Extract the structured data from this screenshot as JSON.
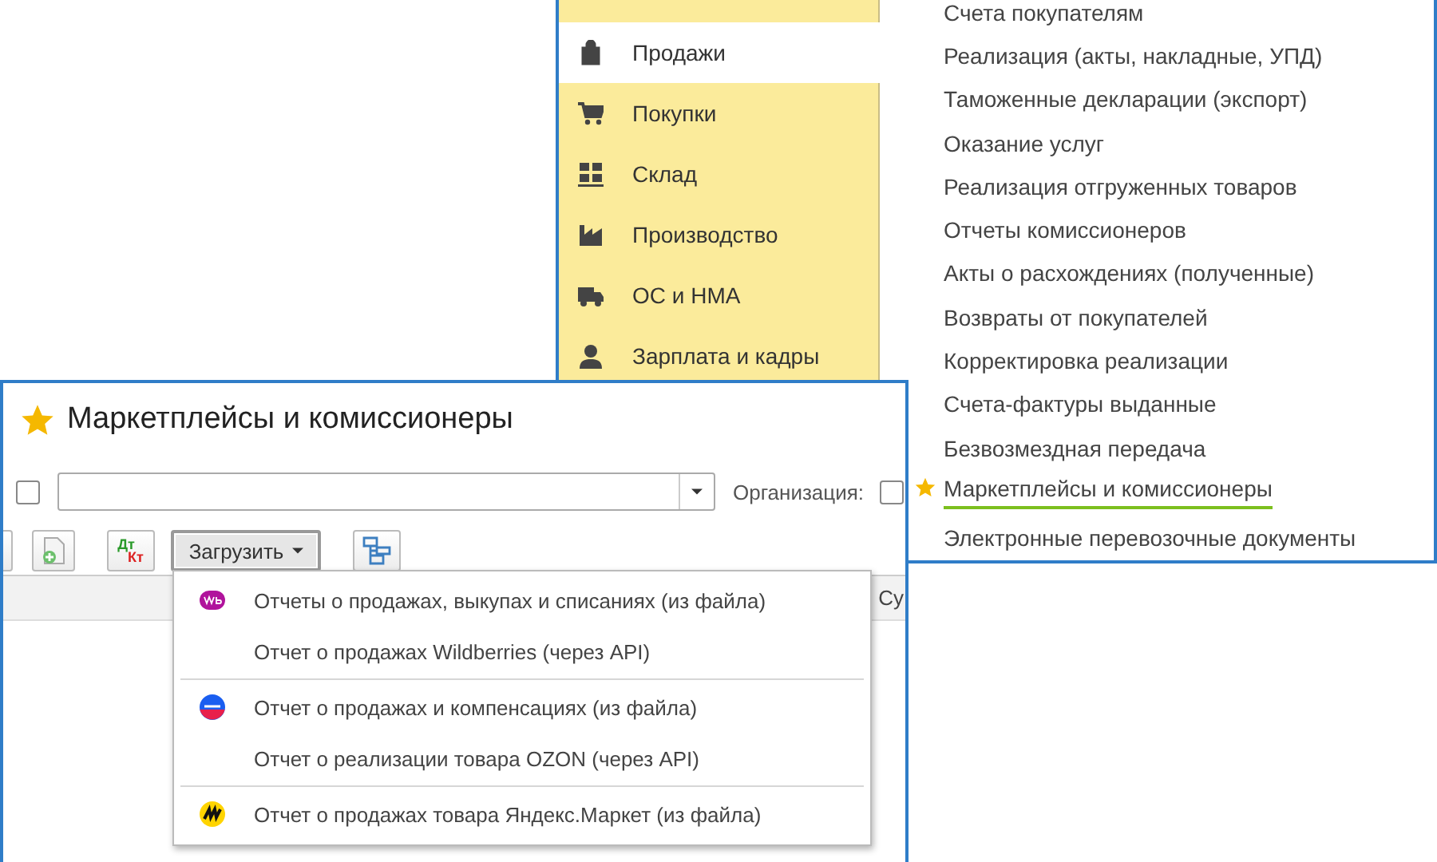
{
  "nav_window": {
    "sections": [
      {
        "label": "Продажи",
        "kind": "bag",
        "selected": true
      },
      {
        "label": "Покупки",
        "kind": "cart",
        "selected": false
      },
      {
        "label": "Склад",
        "kind": "grid",
        "selected": false
      },
      {
        "label": "Производство",
        "kind": "factory",
        "selected": false
      },
      {
        "label": "ОС и НМА",
        "kind": "truck",
        "selected": false
      },
      {
        "label": "Зарплата и кадры",
        "kind": "person",
        "selected": false
      }
    ],
    "commands": [
      {
        "label": "Счета покупателям",
        "favorite": false,
        "selected": false
      },
      {
        "label": "Реализация (акты, накладные, УПД)",
        "favorite": false,
        "selected": false
      },
      {
        "label": "Таможенные декларации (экспорт)",
        "favorite": false,
        "selected": false
      },
      {
        "label": "Оказание услуг",
        "favorite": false,
        "selected": false
      },
      {
        "label": "Реализация отгруженных товаров",
        "favorite": false,
        "selected": false
      },
      {
        "label": "Отчеты комиссионеров",
        "favorite": false,
        "selected": false
      },
      {
        "label": "Акты о расхождениях (полученные)",
        "favorite": false,
        "selected": false
      },
      {
        "label": "Возвраты от покупателей",
        "favorite": false,
        "selected": false
      },
      {
        "label": "Корректировка реализации",
        "favorite": false,
        "selected": false
      },
      {
        "label": "Счета-фактуры выданные",
        "favorite": false,
        "selected": false
      },
      {
        "label": "Безвозмездная передача",
        "favorite": false,
        "selected": false
      },
      {
        "label": "Маркетплейсы и комиссионеры",
        "favorite": true,
        "selected": true
      },
      {
        "label": "Электронные перевозочные документы",
        "favorite": false,
        "selected": false
      }
    ]
  },
  "list_window": {
    "title": "Маркетплейсы и комиссионеры",
    "favorite": true,
    "filter": {
      "checked": false,
      "organization_label": "Организация:",
      "organization_checked": false
    },
    "toolbar": {
      "dt": "Дт",
      "kt": "Кт",
      "load_button": "Загрузить",
      "load_pressed": true
    },
    "column_1": "Су",
    "load_menu": [
      {
        "items": [
          {
            "label": "Отчеты о продажах, выкупах и списаниях (из файла)",
            "kind": "wb"
          },
          {
            "label": "Отчет о продажах Wildberries (через API)",
            "kind": "none"
          }
        ]
      },
      {
        "items": [
          {
            "label": "Отчет о продажах и компенсациях (из файла)",
            "kind": "ozon"
          },
          {
            "label": "Отчет о реализации товара OZON (через API)",
            "kind": "none"
          }
        ]
      },
      {
        "items": [
          {
            "label": "Отчет о продажах товара Яндекс.Маркет (из файла)",
            "kind": "market"
          }
        ]
      }
    ]
  }
}
